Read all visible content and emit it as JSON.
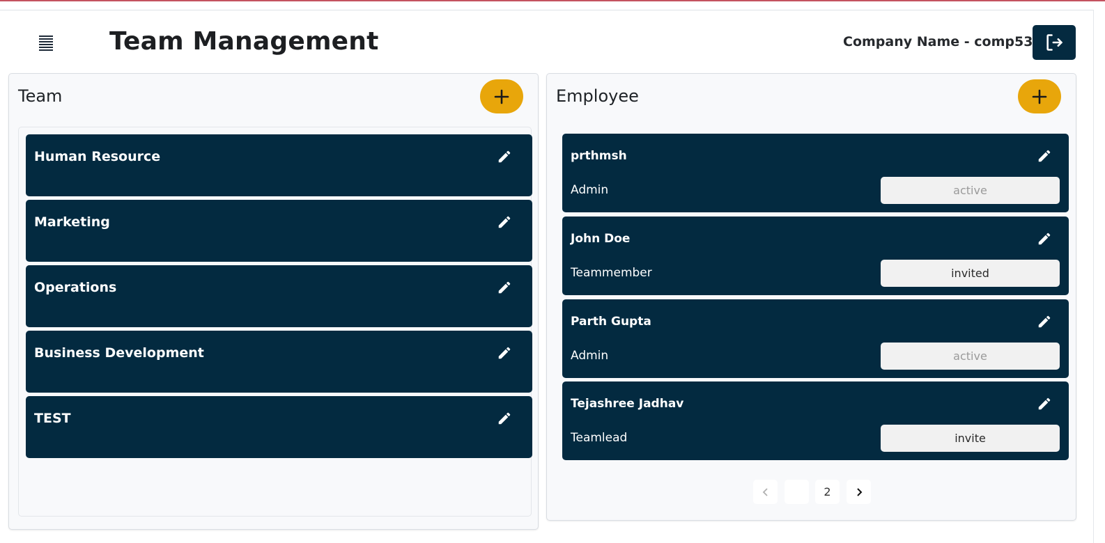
{
  "header": {
    "title": "Team Management",
    "company_label": "Company Name - comp53",
    "menu_icon": "hamburger-icon",
    "logout_icon": "logout-icon"
  },
  "team_panel": {
    "title": "Team",
    "add_icon": "plus-icon",
    "teams": [
      {
        "name": "Human Resource"
      },
      {
        "name": "Marketing"
      },
      {
        "name": "Operations"
      },
      {
        "name": "Business Development"
      },
      {
        "name": "TEST"
      }
    ]
  },
  "employee_panel": {
    "title": "Employee",
    "add_icon": "plus-icon",
    "employees": [
      {
        "name": "prthmsh",
        "role": "Admin",
        "status": "active",
        "status_enabled": false
      },
      {
        "name": "John Doe",
        "role": "Teammember",
        "status": "invited",
        "status_enabled": true
      },
      {
        "name": "Parth Gupta",
        "role": "Admin",
        "status": "active",
        "status_enabled": false
      },
      {
        "name": "Tejashree Jadhav",
        "role": "Teamlead",
        "status": "invite",
        "status_enabled": true
      }
    ],
    "pagination": {
      "prev_icon": "chevron-left-icon",
      "pages": [
        "",
        "2"
      ],
      "next_icon": "chevron-right-icon"
    }
  },
  "colors": {
    "card_bg": "#032a40",
    "accent": "#e8a60b",
    "logout_bg": "#042a40"
  }
}
